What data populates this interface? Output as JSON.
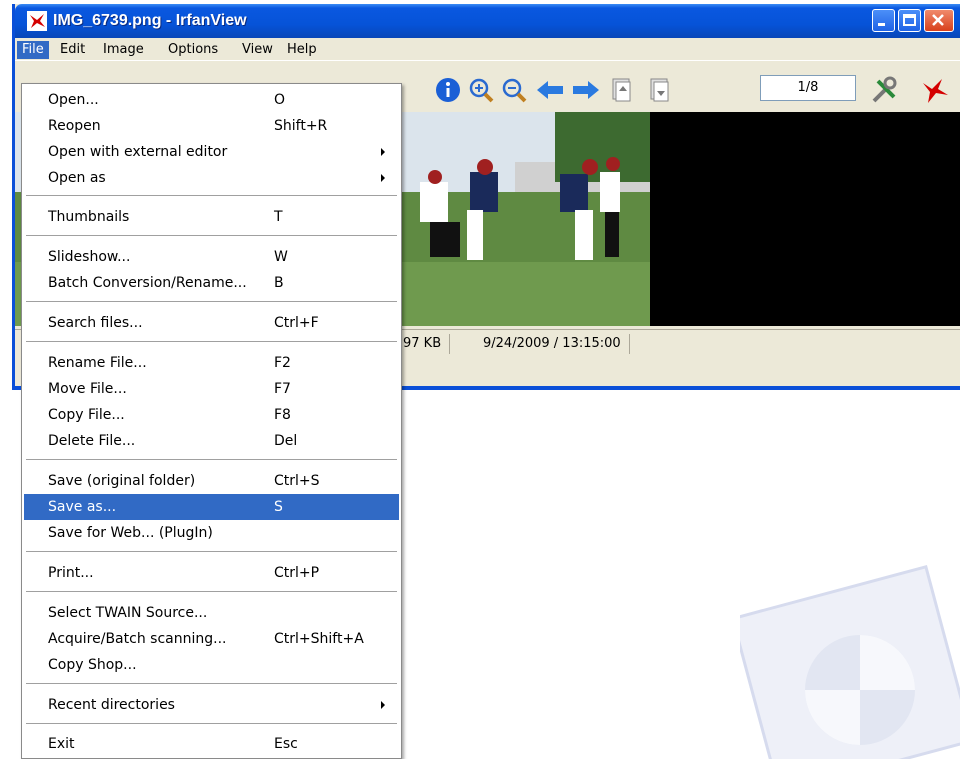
{
  "window": {
    "title": "IMG_6739.png - IrfanView",
    "controls": [
      "minimize",
      "maximize",
      "close"
    ]
  },
  "menubar": [
    "File",
    "Edit",
    "Image",
    "Options",
    "View",
    "Help"
  ],
  "toolbar": {
    "page_indicator": "1/8",
    "icons": [
      "info-icon",
      "zoom-in-icon",
      "zoom-out-icon",
      "previous-arrow-icon",
      "next-arrow-icon",
      "page-up-icon",
      "page-down-icon",
      "settings-icon",
      "irfanview-cat-icon"
    ]
  },
  "status": {
    "size": "97 KB",
    "datetime": "9/24/2009 / 13:15:00"
  },
  "file_menu": {
    "groups": [
      [
        {
          "label": "Open...",
          "shortcut": "O"
        },
        {
          "label": "Reopen",
          "shortcut": "Shift+R"
        },
        {
          "label": "Open with external editor",
          "shortcut": "",
          "submenu": true
        },
        {
          "label": "Open as",
          "shortcut": "",
          "submenu": true
        }
      ],
      [
        {
          "label": "Thumbnails",
          "shortcut": "T"
        }
      ],
      [
        {
          "label": "Slideshow...",
          "shortcut": "W"
        },
        {
          "label": "Batch Conversion/Rename...",
          "shortcut": "B"
        }
      ],
      [
        {
          "label": "Search files...",
          "shortcut": "Ctrl+F"
        }
      ],
      [
        {
          "label": "Rename File...",
          "shortcut": "F2"
        },
        {
          "label": "Move File...",
          "shortcut": "F7"
        },
        {
          "label": "Copy File...",
          "shortcut": "F8"
        },
        {
          "label": "Delete File...",
          "shortcut": "Del"
        }
      ],
      [
        {
          "label": "Save (original folder)",
          "shortcut": "Ctrl+S"
        },
        {
          "label": "Save as...",
          "shortcut": "S",
          "highlighted": true
        },
        {
          "label": "Save for Web... (PlugIn)",
          "shortcut": ""
        }
      ],
      [
        {
          "label": "Print...",
          "shortcut": "Ctrl+P"
        }
      ],
      [
        {
          "label": "Select TWAIN Source...",
          "shortcut": ""
        },
        {
          "label": "Acquire/Batch scanning...",
          "shortcut": "Ctrl+Shift+A"
        },
        {
          "label": "Copy Shop...",
          "shortcut": ""
        }
      ],
      [
        {
          "label": "Recent directories",
          "shortcut": "",
          "submenu": true
        }
      ],
      [
        {
          "label": "Exit",
          "shortcut": "Esc"
        }
      ]
    ]
  },
  "colors": {
    "titlebar": "#0653d8",
    "highlight": "#316ac5",
    "chrome": "#ece9d8"
  }
}
